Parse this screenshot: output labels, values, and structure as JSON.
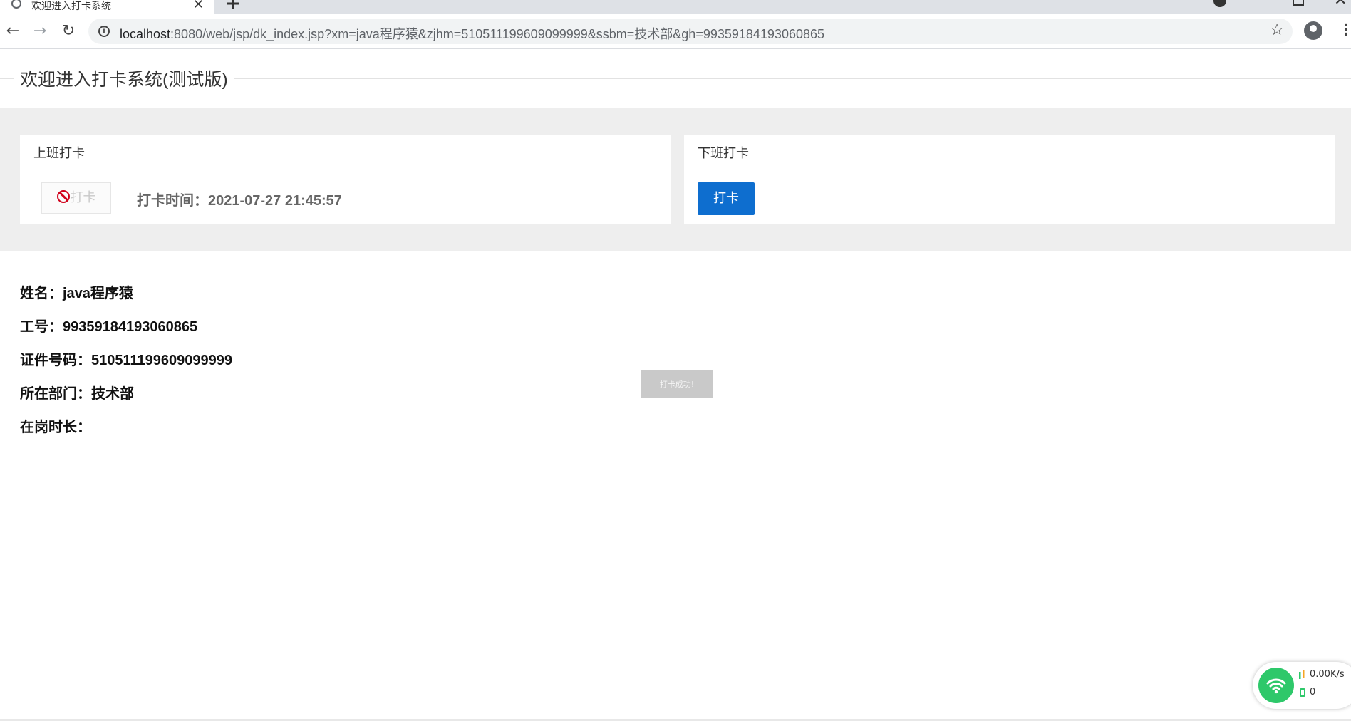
{
  "browser": {
    "tab_title": "欢迎进入打卡系统",
    "url_host": "localhost",
    "url_rest": ":8080/web/jsp/dk_index.jsp?xm=java程序猿&zjhm=510511199609099999&ssbm=技术部&gh=99359184193060865"
  },
  "page": {
    "heading": "欢迎进入打卡系统(测试版)",
    "checkin_card": {
      "title": "上班打卡",
      "button_label": "打卡",
      "time_label": "打卡时间：",
      "time_value": "2021-07-27 21:45:57"
    },
    "checkout_card": {
      "title": "下班打卡",
      "button_label": "打卡"
    },
    "info": {
      "name_label": "姓名：",
      "name_value": "java程序猿",
      "id_label": "工号：",
      "id_value": "99359184193060865",
      "cert_label": "证件号码：",
      "cert_value": "510511199609099999",
      "dept_label": "所在部门：",
      "dept_value": "技术部",
      "duration_label": "在岗时长：",
      "duration_value": ""
    },
    "toast": "打卡成功!"
  },
  "net_widget": {
    "speed": "0.00K/s",
    "connections": "0",
    "accent": "#2ec86a"
  },
  "colors": {
    "primary_button": "#0e6ecf",
    "band": "#eeeeee",
    "disabled_icon": "#d0021b"
  }
}
